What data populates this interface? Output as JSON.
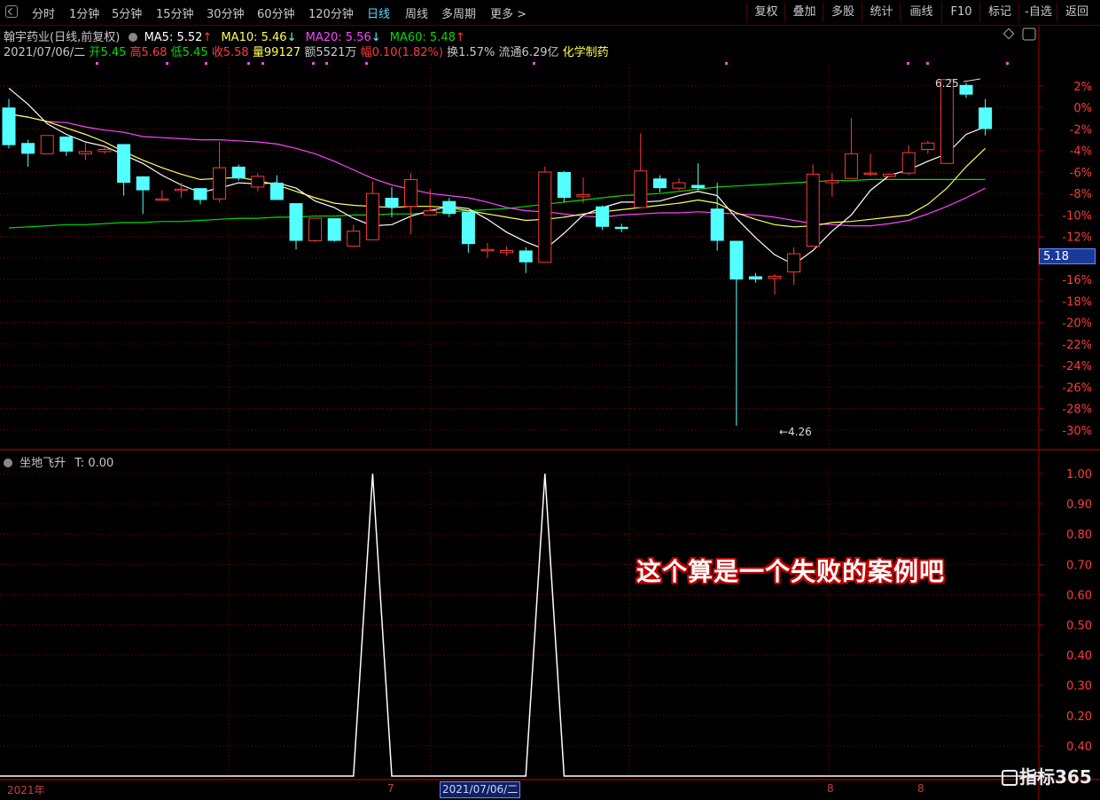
{
  "toolbar": {
    "periods": [
      "分时",
      "1分钟",
      "5分钟",
      "15分钟",
      "30分钟",
      "60分钟",
      "120分钟",
      "日线",
      "周线",
      "多周期",
      "更多"
    ],
    "active_period": "日线",
    "right_buttons": [
      "复权",
      "叠加",
      "多股",
      "统计",
      "画线",
      "F10",
      "标记",
      "-自选",
      "返回"
    ]
  },
  "header": {
    "stock_label": "翰宇药业(日线,前复权)",
    "ma5": "MA5: 5.52",
    "ma10": "MA10: 5.46",
    "ma20": "MA20: 5.56",
    "ma60": "MA60: 5.48",
    "date": "2021/07/06/二",
    "open": "开5.45",
    "high": "高5.68",
    "low": "低5.45",
    "close": "收5.58",
    "volume": "量99127",
    "amount": "额5521万",
    "change": "幅0.10(1.82%)",
    "turnover": "换1.57%",
    "float_cap": "流通6.29亿",
    "sector": "化学制药"
  },
  "colors": {
    "up": "#ff3b3b",
    "down": "#54ffff",
    "ma5": "#ffffff",
    "ma10": "#ffff55",
    "ma20": "#ff44ff",
    "ma60": "#00dd00",
    "grid": "#8b0000"
  },
  "price_tag": "5.18",
  "high_label": "6.25",
  "low_label": "4.26",
  "sub_chart": {
    "title": "坐地飞升",
    "t_value": "T: 0.00"
  },
  "annotation": "这个算是一个失败的案例吧",
  "bottom_axis": {
    "start_label": "2021年",
    "month_labels": [
      "7",
      "8",
      "8"
    ],
    "cursor_date": "2021/07/06/二"
  },
  "watermark": "指标365",
  "chart_data": [
    {
      "type": "candlestick",
      "y_unit": "percent",
      "ylim": [
        -31,
        3
      ],
      "yticks": [
        2,
        0,
        -2,
        -4,
        -6,
        -8,
        -10,
        -12,
        -14,
        -16,
        -18,
        -20,
        -22,
        -24,
        -26,
        -28,
        -30
      ],
      "ytick_labels": [
        "2%",
        "0%",
        "-2%",
        "-4%",
        "-6%",
        "-8%",
        "-10%",
        "-12%",
        "-14%",
        "-16%",
        "-18%",
        "-20%",
        "-22%",
        "-24%",
        "-26%",
        "-28%",
        "-30%"
      ],
      "candles": [
        [
          0.0,
          -3.5,
          0.8,
          -3.8
        ],
        [
          -3.3,
          -4.3,
          -3.0,
          -5.5
        ],
        [
          -4.3,
          -2.6,
          -2.6,
          -4.3
        ],
        [
          -2.7,
          -4.1,
          -2.7,
          -4.5
        ],
        [
          -4.3,
          -4.1,
          -3.3,
          -4.9
        ],
        [
          -4.1,
          -3.9,
          -3.6,
          -4.3
        ],
        [
          -3.4,
          -7.0,
          -3.4,
          -8.2
        ],
        [
          -6.4,
          -7.7,
          -6.4,
          -9.9
        ],
        [
          -8.6,
          -8.5,
          -7.7,
          -8.6
        ],
        [
          -7.7,
          -7.6,
          -7.0,
          -8.4
        ],
        [
          -7.5,
          -8.6,
          -7.5,
          -9.0
        ],
        [
          -8.5,
          -5.6,
          -3.2,
          -8.8
        ],
        [
          -5.5,
          -6.6,
          -5.3,
          -6.8
        ],
        [
          -7.4,
          -6.4,
          -6.1,
          -7.8
        ],
        [
          -7.0,
          -8.6,
          -6.3,
          -8.6
        ],
        [
          -8.9,
          -12.4,
          -8.9,
          -13.2
        ],
        [
          -12.4,
          -10.3,
          -10.3,
          -12.5
        ],
        [
          -10.3,
          -12.4,
          -10.3,
          -12.5
        ],
        [
          -12.9,
          -11.5,
          -10.9,
          -12.9
        ],
        [
          -12.3,
          -8.0,
          -6.9,
          -12.3
        ],
        [
          -8.4,
          -9.3,
          -7.4,
          -10.2
        ],
        [
          -9.2,
          -6.7,
          -6.1,
          -11.8
        ],
        [
          -10.0,
          -9.6,
          -7.6,
          -10.0
        ],
        [
          -8.7,
          -9.9,
          -8.4,
          -10.2
        ],
        [
          -9.7,
          -12.7,
          -9.7,
          -13.5
        ],
        [
          -13.3,
          -13.2,
          -12.6,
          -14.0
        ],
        [
          -13.5,
          -13.3,
          -12.9,
          -13.8
        ],
        [
          -13.3,
          -14.4,
          -13.0,
          -15.4
        ],
        [
          -14.4,
          -6.0,
          -5.5,
          -14.4
        ],
        [
          -6.0,
          -8.4,
          -5.9,
          -8.8
        ],
        [
          -8.3,
          -8.1,
          -6.5,
          -8.9
        ],
        [
          -9.2,
          -11.1,
          -9.1,
          -11.4
        ],
        [
          -11.1,
          -11.3,
          -10.8,
          -11.6
        ],
        [
          -9.3,
          -5.9,
          -2.4,
          -9.3
        ],
        [
          -6.6,
          -7.5,
          -6.3,
          -7.9
        ],
        [
          -7.5,
          -7.0,
          -6.6,
          -7.7
        ],
        [
          -7.2,
          -7.5,
          -5.2,
          -7.7
        ],
        [
          -9.4,
          -12.4,
          -7.0,
          -13.3
        ],
        [
          -12.4,
          -16.0,
          -12.4,
          -29.6
        ],
        [
          -15.7,
          -16.0,
          -15.4,
          -16.3
        ],
        [
          -15.9,
          -15.7,
          -15.5,
          -17.4
        ],
        [
          -15.3,
          -13.6,
          -13.0,
          -16.5
        ],
        [
          -12.9,
          -6.2,
          -5.3,
          -12.9
        ],
        [
          -7.0,
          -6.8,
          -6.1,
          -8.3
        ],
        [
          -6.6,
          -4.3,
          -1.0,
          -6.6
        ],
        [
          -6.2,
          -6.1,
          -4.3,
          -6.4
        ],
        [
          -6.4,
          -6.2,
          -6.1,
          -6.5
        ],
        [
          -6.1,
          -4.2,
          -3.5,
          -6.3
        ],
        [
          -3.9,
          -3.3,
          -3.1,
          -4.3
        ],
        [
          -5.2,
          2.6,
          2.6,
          -5.2
        ],
        [
          2.1,
          1.2,
          2.3,
          0.9
        ],
        [
          0.0,
          -2.0,
          0.8,
          -2.6
        ]
      ],
      "ma5": [
        1.8,
        0.3,
        -1.5,
        -2.5,
        -3.2,
        -3.6,
        -4.4,
        -5.2,
        -6.3,
        -7.2,
        -7.9,
        -7.5,
        -7.0,
        -7.1,
        -7.0,
        -7.5,
        -8.7,
        -9.3,
        -10.3,
        -11.0,
        -10.9,
        -10.1,
        -9.6,
        -9.2,
        -9.4,
        -10.4,
        -11.6,
        -12.5,
        -13.2,
        -11.7,
        -10.0,
        -9.3,
        -8.8,
        -8.8,
        -8.7,
        -8.2,
        -7.8,
        -8.2,
        -10.3,
        -12.1,
        -13.7,
        -14.6,
        -13.3,
        -11.5,
        -10.0,
        -7.7,
        -6.3,
        -5.8,
        -5.0,
        -4.3,
        -2.5,
        -1.8
      ],
      "ma10": [
        -0.6,
        -0.9,
        -1.3,
        -1.9,
        -2.5,
        -3.2,
        -4.1,
        -4.9,
        -5.6,
        -6.2,
        -6.7,
        -6.6,
        -6.5,
        -6.8,
        -7.2,
        -7.8,
        -8.4,
        -8.9,
        -9.1,
        -9.2,
        -9.3,
        -9.2,
        -9.2,
        -9.3,
        -9.6,
        -9.9,
        -10.2,
        -10.5,
        -10.4,
        -10.2,
        -9.9,
        -9.7,
        -9.5,
        -9.3,
        -9.1,
        -8.9,
        -8.6,
        -8.9,
        -9.8,
        -10.4,
        -10.9,
        -11.1,
        -11.0,
        -10.7,
        -10.6,
        -10.4,
        -10.2,
        -10.0,
        -9.0,
        -7.5,
        -5.5,
        -3.8
      ],
      "ma20": [
        -0.6,
        -0.9,
        -1.3,
        -1.4,
        -1.8,
        -2.1,
        -2.3,
        -2.7,
        -2.8,
        -2.9,
        -3.0,
        -3.0,
        -3.1,
        -3.2,
        -3.4,
        -3.8,
        -4.3,
        -5.0,
        -5.8,
        -6.6,
        -7.2,
        -7.6,
        -8.0,
        -8.2,
        -8.4,
        -8.8,
        -9.3,
        -9.6,
        -9.7,
        -9.9,
        -10.1,
        -10.2,
        -10.0,
        -9.9,
        -9.8,
        -9.8,
        -9.7,
        -9.8,
        -9.9,
        -10.0,
        -10.2,
        -10.5,
        -10.8,
        -10.9,
        -11.0,
        -11.0,
        -10.8,
        -10.5,
        -9.9,
        -9.2,
        -8.4,
        -7.5
      ],
      "ma60": [
        -11.2,
        -11.1,
        -11.0,
        -10.9,
        -10.9,
        -10.8,
        -10.7,
        -10.7,
        -10.6,
        -10.6,
        -10.5,
        -10.4,
        -10.3,
        -10.3,
        -10.2,
        -10.2,
        -10.1,
        -10.1,
        -10.0,
        -10.0,
        -9.9,
        -9.9,
        -9.8,
        -9.7,
        -9.6,
        -9.5,
        -9.4,
        -9.2,
        -9.0,
        -8.8,
        -8.6,
        -8.4,
        -8.2,
        -8.1,
        -8.0,
        -7.8,
        -7.6,
        -7.4,
        -7.3,
        -7.2,
        -7.1,
        -7.0,
        -6.9,
        -6.8,
        -6.8,
        -6.7,
        -6.7,
        -6.7,
        -6.7,
        -6.7,
        -6.7,
        -6.7
      ]
    },
    {
      "type": "line",
      "title": "坐地飞升",
      "ylim": [
        0,
        1.05
      ],
      "ytick_labels": [
        "1.00",
        "0.90",
        "0.80",
        "0.70",
        "0.60",
        "0.50",
        "0.40",
        "0.30",
        "0.20",
        "0.40"
      ],
      "values": [
        0,
        0,
        0,
        0,
        0,
        0,
        0,
        0,
        0,
        0,
        0,
        0,
        0,
        0,
        0,
        0,
        0,
        0,
        0,
        1,
        0,
        0,
        0,
        0,
        0,
        0,
        0,
        0,
        1,
        0,
        0,
        0,
        0,
        0,
        0,
        0,
        0,
        0,
        0,
        0,
        0,
        0,
        0,
        0,
        0,
        0,
        0,
        0,
        0,
        0,
        0,
        0
      ]
    }
  ]
}
